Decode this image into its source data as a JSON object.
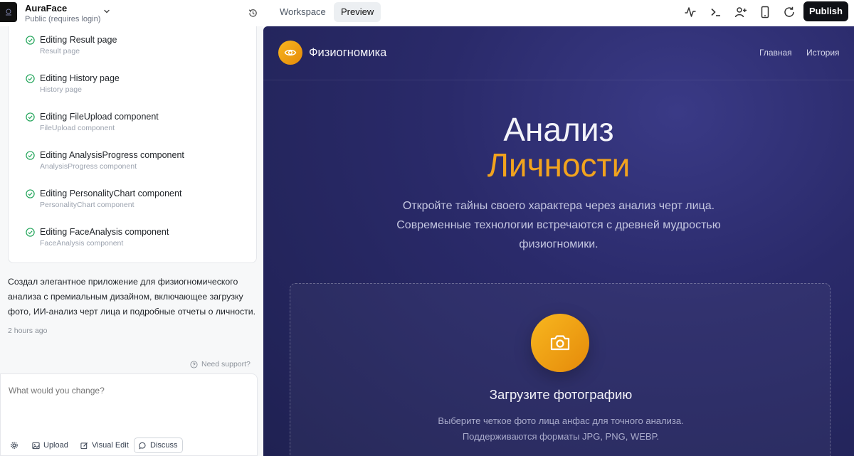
{
  "topbar": {
    "app_name": "AuraFace",
    "visibility": "Public (requires login)",
    "tabs": [
      {
        "label": "Workspace",
        "active": false
      },
      {
        "label": "Preview",
        "active": true
      }
    ],
    "icons": [
      "activity-icon",
      "terminal-icon",
      "add-user-icon",
      "mobile-icon",
      "refresh-icon"
    ],
    "publish_label": "Publish"
  },
  "chat": {
    "steps": [
      {
        "title": "Editing Result page",
        "subtitle": "Result page"
      },
      {
        "title": "Editing History page",
        "subtitle": "History page"
      },
      {
        "title": "Editing FileUpload component",
        "subtitle": "FileUpload component"
      },
      {
        "title": "Editing AnalysisProgress component",
        "subtitle": "AnalysisProgress component"
      },
      {
        "title": "Editing PersonalityChart component",
        "subtitle": "PersonalityChart component"
      },
      {
        "title": "Editing FaceAnalysis component",
        "subtitle": "FaceAnalysis component"
      }
    ],
    "message": "Создал элегантное приложение для физиогномического анализа с премиальным дизайном, включающее загрузку фото, ИИ-анализ черт лица и подробные отчеты о личности.",
    "timestamp": "2 hours ago",
    "support_label": "Need support?",
    "composer": {
      "placeholder": "What would you change?",
      "upload_label": "Upload",
      "visual_edit_label": "Visual Edit",
      "discuss_label": "Discuss"
    }
  },
  "preview": {
    "brand": "Физиогномика",
    "nav": [
      "Главная",
      "История"
    ],
    "hero_line1": "Анализ",
    "hero_line2": "Личности",
    "hero_desc": "Откройте тайны своего характера через анализ черт лица. Современные технологии встречаются с древней мудростью физиогномики.",
    "upload_title": "Загрузите фотографию",
    "upload_desc_1": "Выберите четкое фото лица анфас для точного анализа.",
    "upload_desc_2": "Поддерживаются форматы JPG, PNG, WEBP.",
    "accent_color": "#f2a31e",
    "background_color": "#2a2a6a"
  }
}
